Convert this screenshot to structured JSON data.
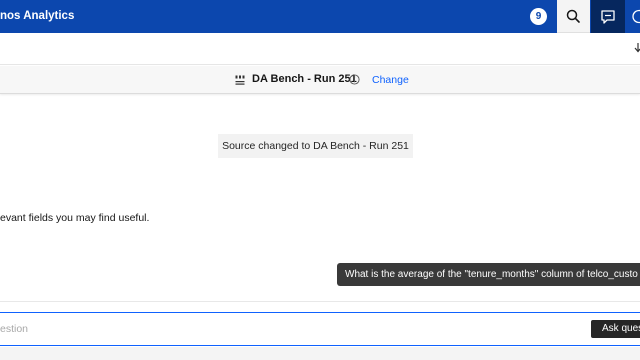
{
  "header": {
    "app_title": "nos Analytics",
    "notification_count": "9",
    "icons": [
      "search-icon",
      "chat-icon",
      "help-icon"
    ]
  },
  "source_bar": {
    "source_name": "DA Bench - Run 251",
    "change_label": "Change",
    "icons": [
      "database-icon",
      "info-icon"
    ]
  },
  "conversation": {
    "notice": "Source changed to DA Bench - Run 251",
    "relevant_fields_text": "evant fields you may find useful.",
    "user_message": "What is the average of the \"tenure_months\" column of telco_custo"
  },
  "composer": {
    "placeholder": "estion",
    "ask_button": "Ask ques"
  },
  "colors": {
    "header_bg": "#0c47ae",
    "chat_active_bg": "#06275e",
    "link": "#0f62fe",
    "bubble_bg": "#393939"
  }
}
